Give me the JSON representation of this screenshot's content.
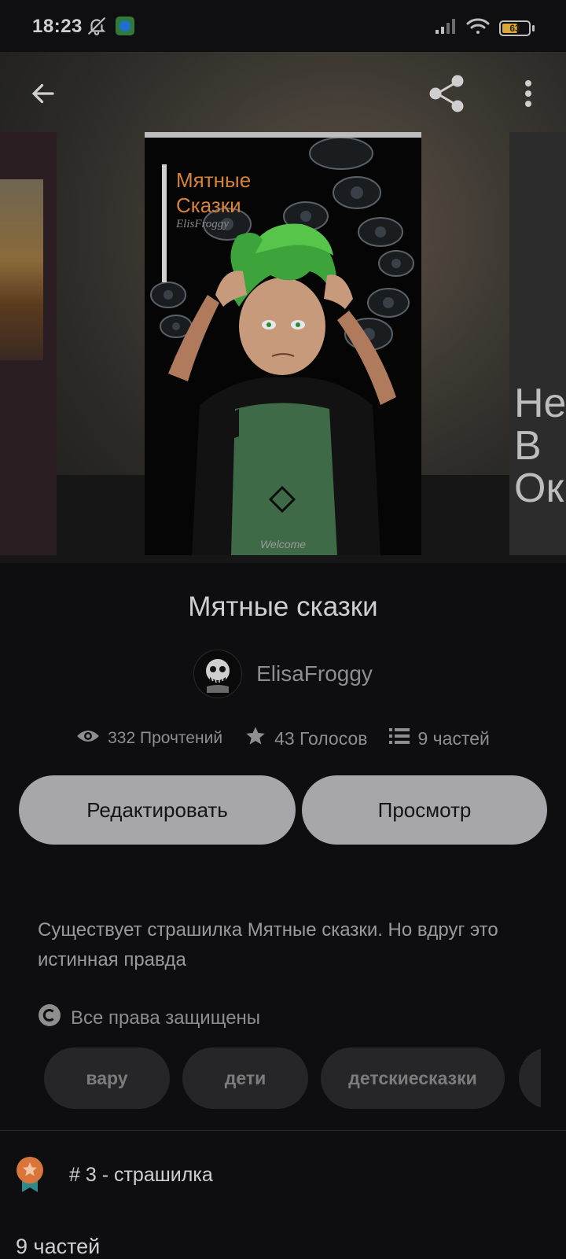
{
  "status_bar": {
    "time": "18:23",
    "battery_level": 63,
    "battery_label": "63",
    "icons": [
      "bell-off-icon",
      "app-notification-icon",
      "signal-icon",
      "wifi-icon",
      "battery-icon"
    ]
  },
  "top_bar": {
    "back_icon": "arrow-left-icon",
    "share_icon": "share-icon",
    "more_icon": "more-vertical-icon"
  },
  "cover": {
    "title_line1": "Мятные",
    "title_line2": "Сказки",
    "author": "ElisFroggy",
    "footer": "Welcome"
  },
  "cover_right": {
    "text": "Не\nВ\nОк"
  },
  "book": {
    "title": "Мятные сказки",
    "author_name": "ElisaFroggy",
    "reads": "332 Прочтений",
    "votes": "43 Голосов",
    "parts": "9 частей"
  },
  "actions": {
    "edit_label": "Редактировать",
    "preview_label": "Просмотр"
  },
  "description": "Существует страшилка Мятные сказки. Но вдруг это истинная правда",
  "copyright": "Все права защищены",
  "tags": [
    "вару",
    "дети",
    "детскиесказки"
  ],
  "rank": {
    "text": "# 3 - страшилка"
  },
  "parts_header": "9 частей",
  "colors": {
    "background": "#0e0e11",
    "button": "#a7a6aa",
    "tag": "#262628",
    "cover_title": "#d6823a",
    "rank_badge": "#d9743a",
    "rank_ribbon": "#2f8a8a"
  }
}
